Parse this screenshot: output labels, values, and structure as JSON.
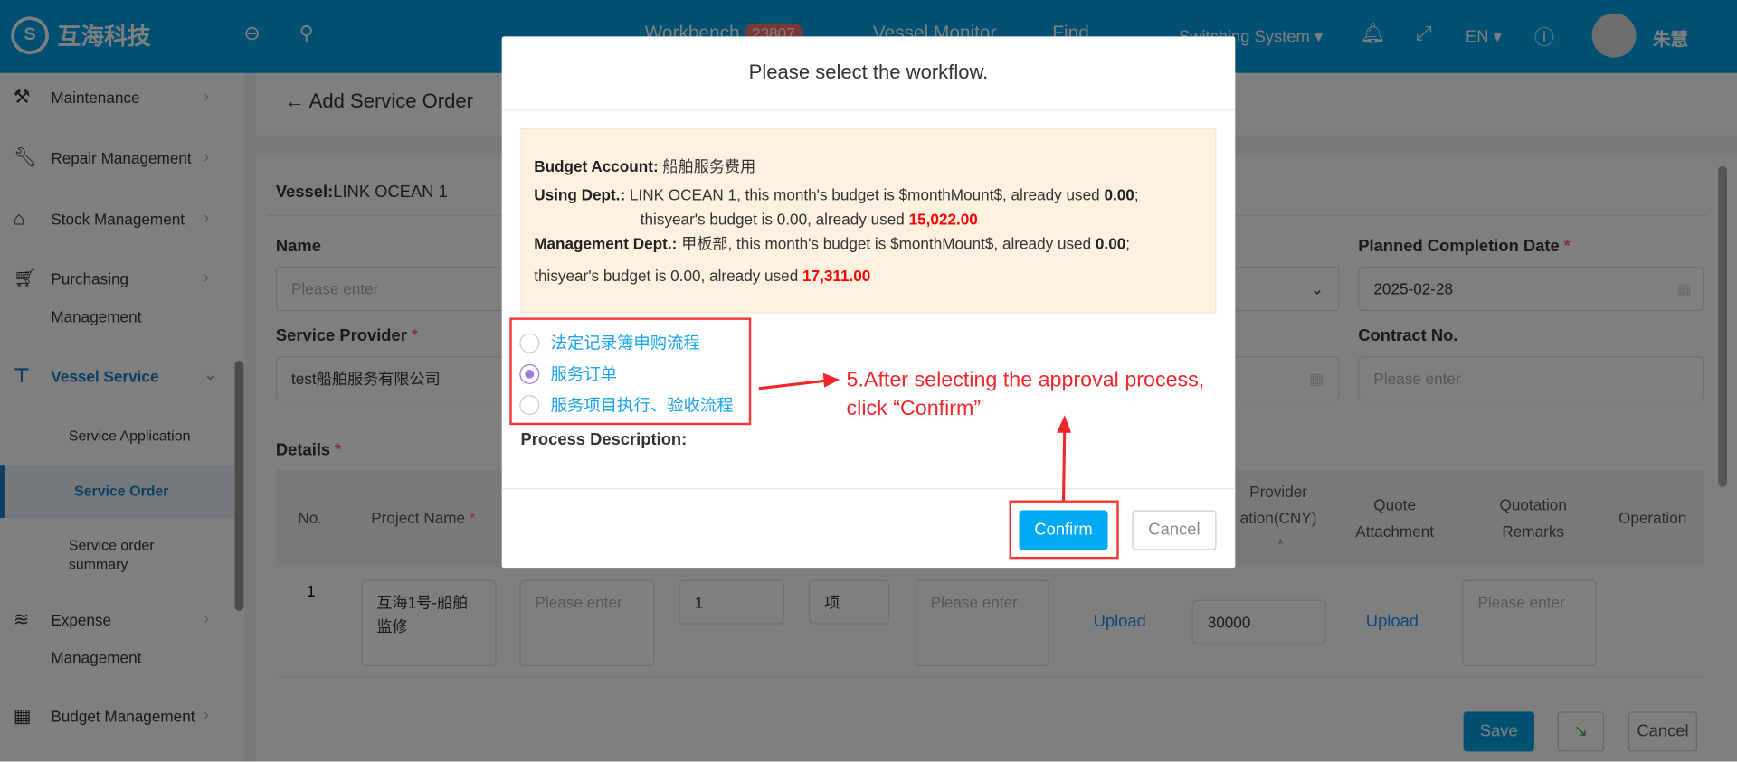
{
  "header": {
    "logo_text": "互海科技",
    "nav": [
      {
        "label": "Workbench",
        "badge": "23807"
      },
      {
        "label": "Vessel Monitor"
      },
      {
        "label": "Find"
      }
    ],
    "switching": "Switching System",
    "lang": "EN",
    "user": "朱慧"
  },
  "sidebar": {
    "items": [
      {
        "label": "Maintenance",
        "icon": "hammer-icon"
      },
      {
        "label": "Repair Management",
        "icon": "wrench-icon"
      },
      {
        "label": "Stock Management",
        "icon": "home-icon"
      },
      {
        "label": "Purchasing",
        "label2": "Management",
        "icon": "cart-icon"
      },
      {
        "label": "Vessel Service",
        "icon": "paint-roller-icon"
      },
      {
        "label": "Expense",
        "label2": "Management",
        "icon": "database-icon"
      },
      {
        "label": "Budget Management",
        "icon": "calculator-icon"
      }
    ],
    "sub": [
      {
        "label": "Service Application"
      },
      {
        "label": "Service Order"
      },
      {
        "label": "Service order",
        "label2": "summary"
      }
    ]
  },
  "page": {
    "title": "Add Service Order",
    "vessel_label": "Vessel:",
    "vessel": "LINK OCEAN 1",
    "name_label": "Name",
    "name_placeholder": "Please enter",
    "provider_label": "Service Provider",
    "provider_value": "test船舶服务有限公司",
    "planned_label": "Planned Completion Date",
    "planned_value": "2025-02-28",
    "contract_label": "Contract No.",
    "contract_placeholder": "Please enter",
    "details_label": "Details",
    "table": {
      "headers": [
        "No.",
        "Project Name",
        "Provider",
        "ation(CNY)",
        "Quote",
        "Attachment",
        "Quotation",
        "Remarks",
        "Operation"
      ],
      "row": {
        "no": "1",
        "project": "互海1号-船舶监修",
        "desc": "Please enter",
        "qty": "1",
        "unit": "项",
        "remark": "Please enter",
        "upload1": "Upload",
        "price": "30000",
        "upload2": "Upload",
        "qremark": "Please enter"
      }
    },
    "save": "Save",
    "cancel": "Cancel"
  },
  "modal": {
    "title": "Please select the workflow.",
    "budget_account_label": "Budget Account:",
    "budget_account": "船舶服务费用",
    "using_label": "Using Dept.:",
    "using_text": "LINK OCEAN 1, this month's budget is $monthMount$, already used",
    "using_month_used": "0.00",
    "using_year_text": "thisyear's budget is 0.00, already used",
    "using_year_used": "15,022.00",
    "mgmt_label": "Management Dept.:",
    "mgmt_text": "甲板部, this month's budget is $monthMount$, already used",
    "mgmt_month_used": "0.00",
    "mgmt_year_text": "thisyear's budget is 0.00, already used",
    "mgmt_year_used": "17,311.00",
    "options": [
      {
        "label": "法定记录簿申购流程",
        "selected": false
      },
      {
        "label": "服务订单",
        "selected": true
      },
      {
        "label": "服务项目执行、验收流程",
        "selected": false
      }
    ],
    "process_label": "Process Description:",
    "confirm": "Confirm",
    "cancel": "Cancel"
  },
  "annotation": {
    "line1": "5.After selecting the approval process,",
    "line2": "click  “Confirm”"
  },
  "colors": {
    "brand": "#00a0e9",
    "annotation": "#f0262b",
    "confirm": "#00a0e9"
  }
}
